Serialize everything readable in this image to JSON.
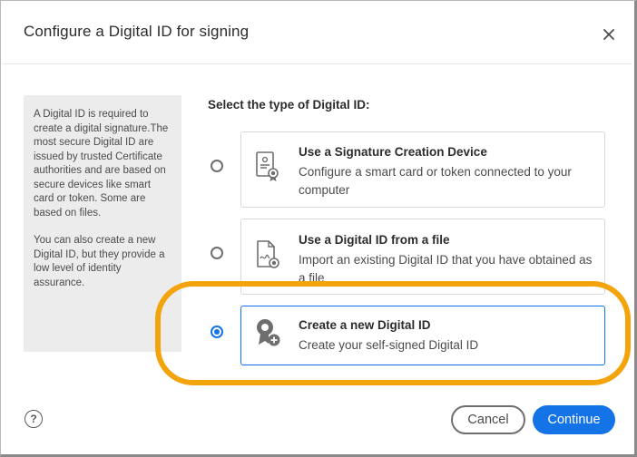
{
  "dialog": {
    "title": "Configure a Digital ID for signing"
  },
  "info": {
    "paragraph1": "A Digital ID is required to create a digital signature.The most secure Digital ID are issued by trusted Certificate authorities and are based on secure devices like smart card or token. Some are based on files.",
    "paragraph2": "You can also create a new Digital ID, but they provide a low level of identity assurance."
  },
  "section_label": "Select the type of Digital ID:",
  "options": [
    {
      "heading": "Use a Signature Creation Device",
      "description": "Configure a smart card or token connected to your computer",
      "icon": "certificate-device-icon",
      "selected": false
    },
    {
      "heading": "Use a Digital ID from a file",
      "description": "Import an existing Digital ID that you have obtained as a file",
      "icon": "signed-file-icon",
      "selected": false
    },
    {
      "heading": "Create a new Digital ID",
      "description": "Create your self-signed Digital ID",
      "icon": "new-badge-icon",
      "selected": true
    }
  ],
  "footer": {
    "help_label": "?",
    "cancel_label": "Cancel",
    "continue_label": "Continue"
  },
  "colors": {
    "accent": "#1473e6",
    "highlight": "#f3a40d"
  }
}
